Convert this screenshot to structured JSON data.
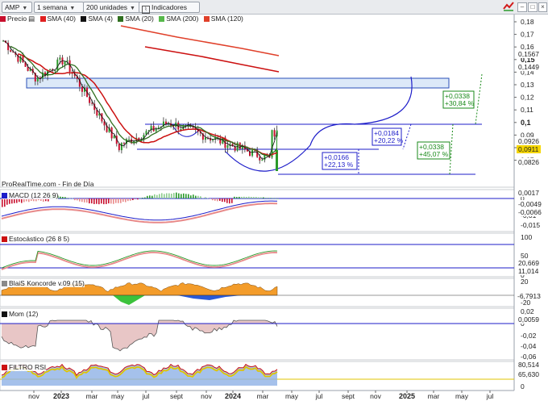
{
  "toolbar": {
    "symbol": "AMP",
    "period": "1 semana",
    "units": "200 unidades",
    "indicators": "Indicadores",
    "colors": {
      "background": "#e9ebee",
      "border": "#9aa1ab"
    }
  },
  "legend": {
    "precio": "Precio",
    "items": [
      {
        "label": "SMA (40)",
        "color": "#e02020"
      },
      {
        "label": "SMA (4)",
        "color": "#111111"
      },
      {
        "label": "SMA (20)",
        "color": "#2f6f1f"
      },
      {
        "label": "SMA (200)",
        "color": "#56b84a"
      },
      {
        "label": "SMA (120)",
        "color": "#e0402a"
      }
    ]
  },
  "attribution": "ProRealTime.com - Fin de Día",
  "price_axis": {
    "ticks": [
      "0,18",
      "0,17",
      "0,16",
      "0,15",
      "0,14",
      "0,13",
      "0,12",
      "0,11",
      "0,1",
      "0,09",
      "0,08",
      "0,07"
    ],
    "tags": [
      {
        "text": "0,1567",
        "color": "#cc1111",
        "value": 0.1567
      },
      {
        "text": "0,1449",
        "color": "#cc1111",
        "value": 0.1449
      },
      {
        "text": "0,0926",
        "color": "#cc1111",
        "value": 0.0926
      },
      {
        "text": "0,0911",
        "color": "#111111",
        "value": 0.0911,
        "highlight": "#f5d600"
      },
      {
        "text": "0,0826",
        "color": "#2f6f1f",
        "value": 0.0826
      }
    ]
  },
  "price_annotations": [
    {
      "line1": "+0,0166",
      "line2": "+22,13 %",
      "color": "#1d1dc9"
    },
    {
      "line1": "+0,0184",
      "line2": "+20,22 %",
      "color": "#1d1dc9"
    },
    {
      "line1": "+0,0338",
      "line2": "+45,07 %",
      "color": "#1a8a1a"
    },
    {
      "line1": "+0,0338",
      "line2": "+30,84 %",
      "color": "#1a8a1a"
    }
  ],
  "macd": {
    "label": "MACD (12 26 9)",
    "ticks": [
      "0,005",
      "0",
      "-0,005",
      "-0,01",
      "-0,015"
    ],
    "tags": [
      {
        "text": "0,0017",
        "color": "#1d1dc9"
      },
      {
        "text": "-0,0049",
        "color": "#222222"
      },
      {
        "text": "-0,0066",
        "color": "#cc1111"
      }
    ]
  },
  "stoch": {
    "label": "Estocástico (26 8 5)",
    "ticks": [
      "100",
      "50",
      "0"
    ],
    "tags": [
      {
        "text": "20,669",
        "color": "#2f6f1f"
      },
      {
        "text": "11,014",
        "color": "#cc1111"
      }
    ]
  },
  "koncorde": {
    "label": "BlaiS Koncorde v.09 (15)",
    "ticks": [
      "20",
      "0",
      "-20"
    ],
    "tags": [
      {
        "text": "-6,7913",
        "color": "#1d8fd6"
      }
    ]
  },
  "mom": {
    "label": "Mom (12)",
    "ticks": [
      "0,02",
      "0",
      "-0,02",
      "-0,04",
      "-0,06"
    ],
    "tags": [
      {
        "text": "0,0059",
        "color": "#222222"
      }
    ]
  },
  "rsi": {
    "label": "FILTRO RSI",
    "ticks": [
      "0"
    ],
    "tags": [
      {
        "text": "80,514",
        "color": "#1d1dc9"
      },
      {
        "text": "65,630",
        "color": "#e0c400"
      }
    ]
  },
  "time_axis": {
    "labels": [
      "nov",
      "2023",
      "mar",
      "may",
      "jul",
      "sept",
      "nov",
      "2024",
      "mar",
      "may",
      "jul",
      "sept",
      "nov",
      "2025",
      "mar",
      "may",
      "jul"
    ],
    "bold": [
      "2023",
      "2024",
      "2025"
    ]
  }
}
